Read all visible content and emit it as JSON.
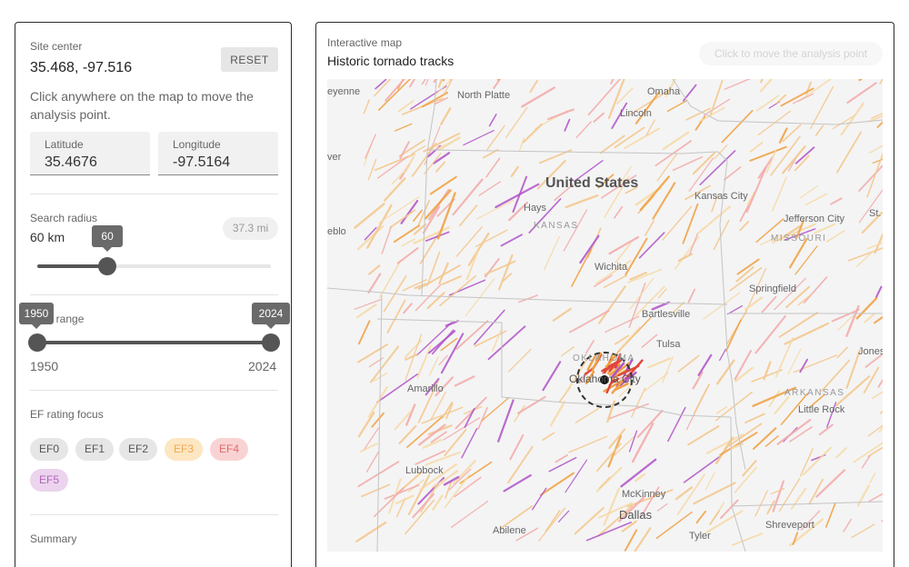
{
  "sidebar": {
    "site_center_label": "Site center",
    "site_center_value": "35.468, -97.516",
    "reset_label": "RESET",
    "hint": "Click anywhere on the map to move the analysis point.",
    "latitude": {
      "label": "Latitude",
      "value": "35.4676"
    },
    "longitude": {
      "label": "Longitude",
      "value": "-97.5164"
    },
    "radius": {
      "label": "Search radius",
      "value_text": "60 km",
      "miles": "37.3 mi",
      "tooltip": "60",
      "value": 60,
      "min": 0,
      "max": 200
    },
    "date_range": {
      "label": "Date range",
      "from": "1950",
      "to": "2024",
      "tooltip_from": "1950",
      "tooltip_to": "2024"
    },
    "ef": {
      "label": "EF rating focus",
      "chips": [
        {
          "label": "EF0",
          "bg": "#e6e6e6",
          "fg": "#555555"
        },
        {
          "label": "EF1",
          "bg": "#e6e6e6",
          "fg": "#555555"
        },
        {
          "label": "EF2",
          "bg": "#e6e6e6",
          "fg": "#555555"
        },
        {
          "label": "EF3",
          "bg": "#fde6c2",
          "fg": "#f0a850"
        },
        {
          "label": "EF4",
          "bg": "#f9d3d3",
          "fg": "#e36b6b"
        },
        {
          "label": "EF5",
          "bg": "#ecd3ee",
          "fg": "#b066b8"
        }
      ]
    },
    "summary_label": "Summary"
  },
  "map": {
    "kicker": "Interactive map",
    "title": "Historic tornado tracks",
    "move_button": "Click to move the analysis point",
    "labels": {
      "cheyenne": "eyenne",
      "north_platte": "North Platte",
      "omaha": "Omaha",
      "lincoln": "Lincoln",
      "denver": "ver",
      "pueblo": "eblo",
      "united_states": "United States",
      "kansas_city": "Kansas City",
      "hays": "Hays",
      "kansas": "KANSAS",
      "jefferson_city": "Jefferson City",
      "st_louis": "St.",
      "missouri": "MISSOURI",
      "wichita": "Wichita",
      "springfield": "Springfield",
      "bartlesville": "Bartlesville",
      "oklahoma": "OKLAHOMA",
      "tulsa": "Tulsa",
      "oklahoma_city": "Oklahoma City",
      "amarillo": "Amarillo",
      "jonesboro": "Jones",
      "arkansas": "ARKANSAS",
      "little_rock": "Little Rock",
      "lubbock": "Lubbock",
      "mckinney": "McKinney",
      "dallas": "Dallas",
      "abilene": "Abilene",
      "tyler": "Tyler",
      "shreveport": "Shreveport"
    },
    "colors": {
      "ef0": "#f7d9a6",
      "ef1": "#f5c68a",
      "ef2": "#f3a9a9",
      "ef3": "#f0a040",
      "ef4": "#e0453a",
      "ef5": "#b052c8"
    }
  }
}
